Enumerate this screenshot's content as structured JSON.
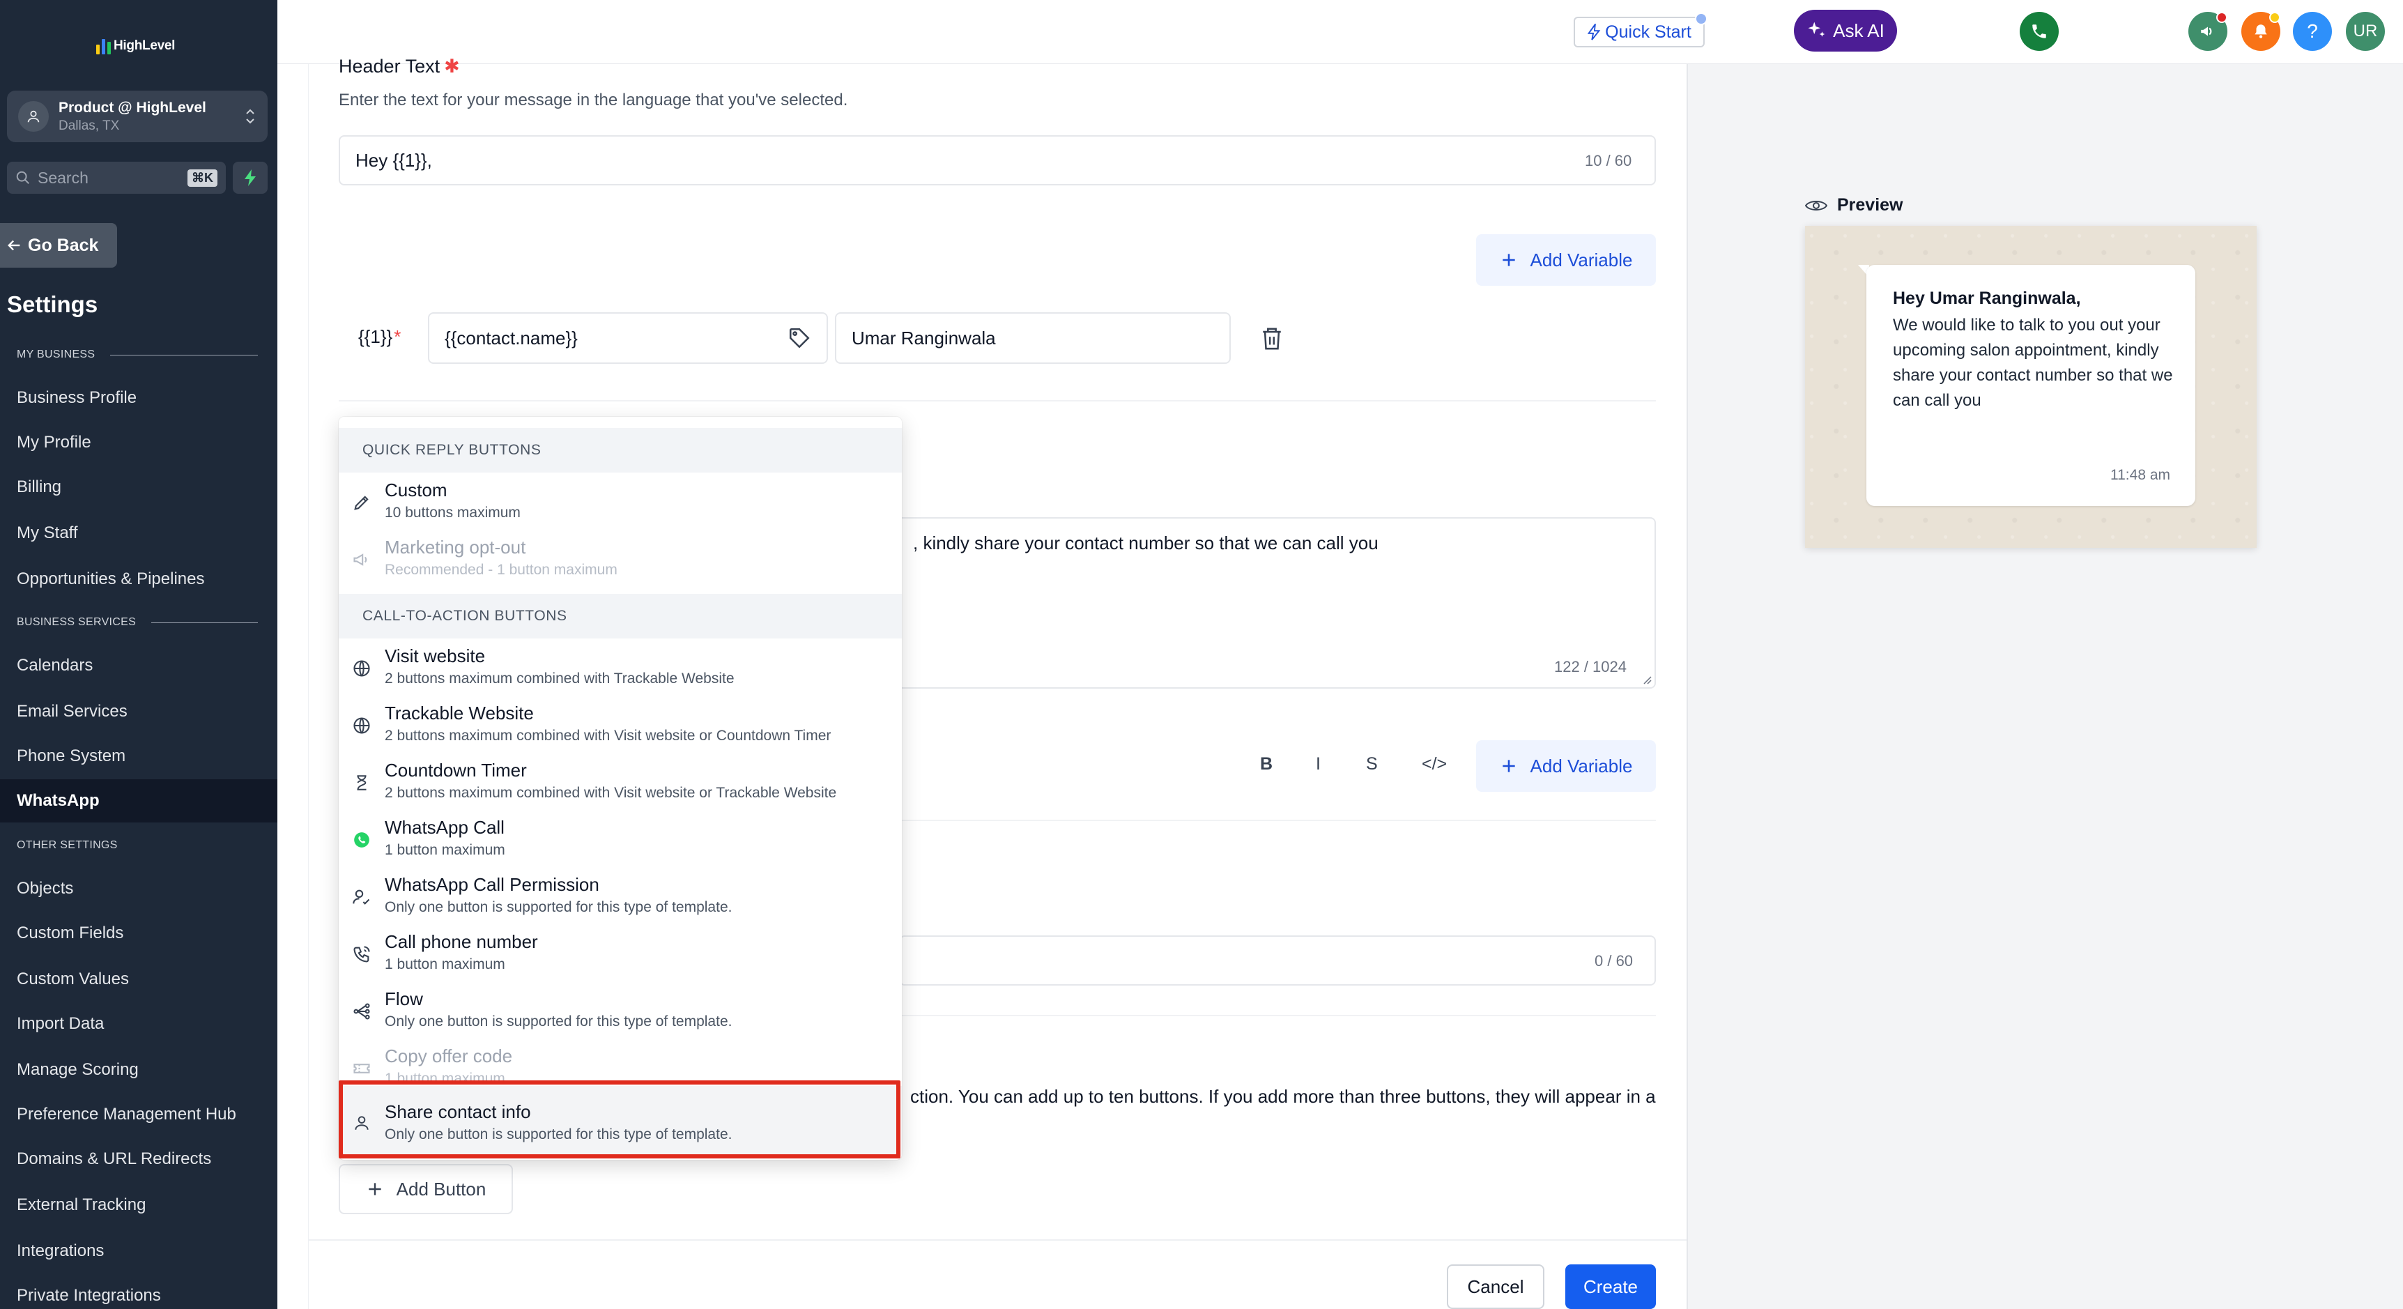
{
  "sidebar": {
    "logo_text": "HighLevel",
    "account": {
      "name": "Product @ HighLevel",
      "location": "Dallas, TX"
    },
    "search": {
      "placeholder": "Search",
      "shortcut": "⌘K"
    },
    "go_back": "Go Back",
    "settings_title": "Settings",
    "sections": {
      "my_business": "MY BUSINESS",
      "business_services": "BUSINESS SERVICES",
      "other_settings": "OTHER SETTINGS"
    },
    "items": {
      "business_profile": "Business Profile",
      "my_profile": "My Profile",
      "billing": "Billing",
      "my_staff": "My Staff",
      "opportunities": "Opportunities & Pipelines",
      "calendars": "Calendars",
      "email_services": "Email Services",
      "phone_system": "Phone System",
      "whatsapp": "WhatsApp",
      "objects": "Objects",
      "custom_fields": "Custom Fields",
      "custom_values": "Custom Values",
      "import_data": "Import Data",
      "manage_scoring": "Manage Scoring",
      "preference_hub": "Preference Management Hub",
      "domains": "Domains & URL Redirects",
      "external_tracking": "External Tracking",
      "integrations": "Integrations",
      "private_integrations": "Private Integrations"
    },
    "active_item": "WhatsApp"
  },
  "topbar": {
    "quick_start": "Quick Start",
    "ask_ai": "Ask AI",
    "help": "?",
    "user_initials": "UR",
    "colors": {
      "phone": "#15803d",
      "ask_ai": "#4c1d95",
      "megaphone": "#3f8f6b",
      "bell": "#f97316",
      "help": "#2e90fa",
      "avatar": "#3f8f6b"
    }
  },
  "form": {
    "header_label": "Header Text",
    "header_help": "Enter the text for your message in the language that you've selected.",
    "header_value": "Hey {{1}},",
    "header_counter": "10 / 60",
    "add_variable": "Add Variable",
    "variable": {
      "key": "{{1}}",
      "value": "{{contact.name}}",
      "sample": "Umar Ranginwala"
    },
    "body_visible_text": ", kindly share your contact number so that we can call you",
    "body_counter": "122 / 1024",
    "format_buttons": {
      "bold": "B",
      "italic": "I",
      "strike": "S",
      "code": "</>"
    },
    "footer_counter": "0 / 60",
    "buttons_help_visible": "ction. You can add up to ten buttons. If you add more than three buttons, they will appear in a",
    "add_button": "Add Button",
    "cancel": "Cancel",
    "create": "Create"
  },
  "dropdown": {
    "quick_reply_header": "QUICK REPLY BUTTONS",
    "cta_header": "CALL-TO-ACTION BUTTONS",
    "quick_reply": [
      {
        "icon": "pencil-icon",
        "title": "Custom",
        "subtitle": "10 buttons maximum",
        "disabled": false
      },
      {
        "icon": "megaphone-icon",
        "title": "Marketing opt-out",
        "subtitle": "Recommended - 1 button maximum",
        "disabled": true
      }
    ],
    "cta": [
      {
        "icon": "globe-icon",
        "title": "Visit website",
        "subtitle": "2 buttons maximum combined with Trackable Website",
        "disabled": false
      },
      {
        "icon": "globe-icon",
        "title": "Trackable Website",
        "subtitle": "2 buttons maximum combined with Visit website or Countdown Timer",
        "disabled": false
      },
      {
        "icon": "hourglass-icon",
        "title": "Countdown Timer",
        "subtitle": "2 buttons maximum combined with Visit website or Trackable Website",
        "disabled": false
      },
      {
        "icon": "whatsapp-icon",
        "title": "WhatsApp Call",
        "subtitle": "1 button maximum",
        "disabled": false
      },
      {
        "icon": "user-check-icon",
        "title": "WhatsApp Call Permission",
        "subtitle": "Only one button is supported for this type of template.",
        "disabled": false
      },
      {
        "icon": "phone-icon",
        "title": "Call phone number",
        "subtitle": "1 button maximum",
        "disabled": false
      },
      {
        "icon": "flow-icon",
        "title": "Flow",
        "subtitle": "Only one button is supported for this type of template.",
        "disabled": false
      },
      {
        "icon": "ticket-icon",
        "title": "Copy offer code",
        "subtitle": "1 button maximum",
        "disabled": true
      },
      {
        "icon": "user-icon",
        "title": "Share contact info",
        "subtitle": "Only one button is supported for this type of template.",
        "disabled": false,
        "highlighted": true
      }
    ]
  },
  "preview": {
    "label": "Preview",
    "title": "Hey Umar Ranginwala,",
    "body": "We would like to talk to you out your upcoming salon appointment, kindly share your contact number so that we can call you",
    "time": "11:48 am"
  }
}
